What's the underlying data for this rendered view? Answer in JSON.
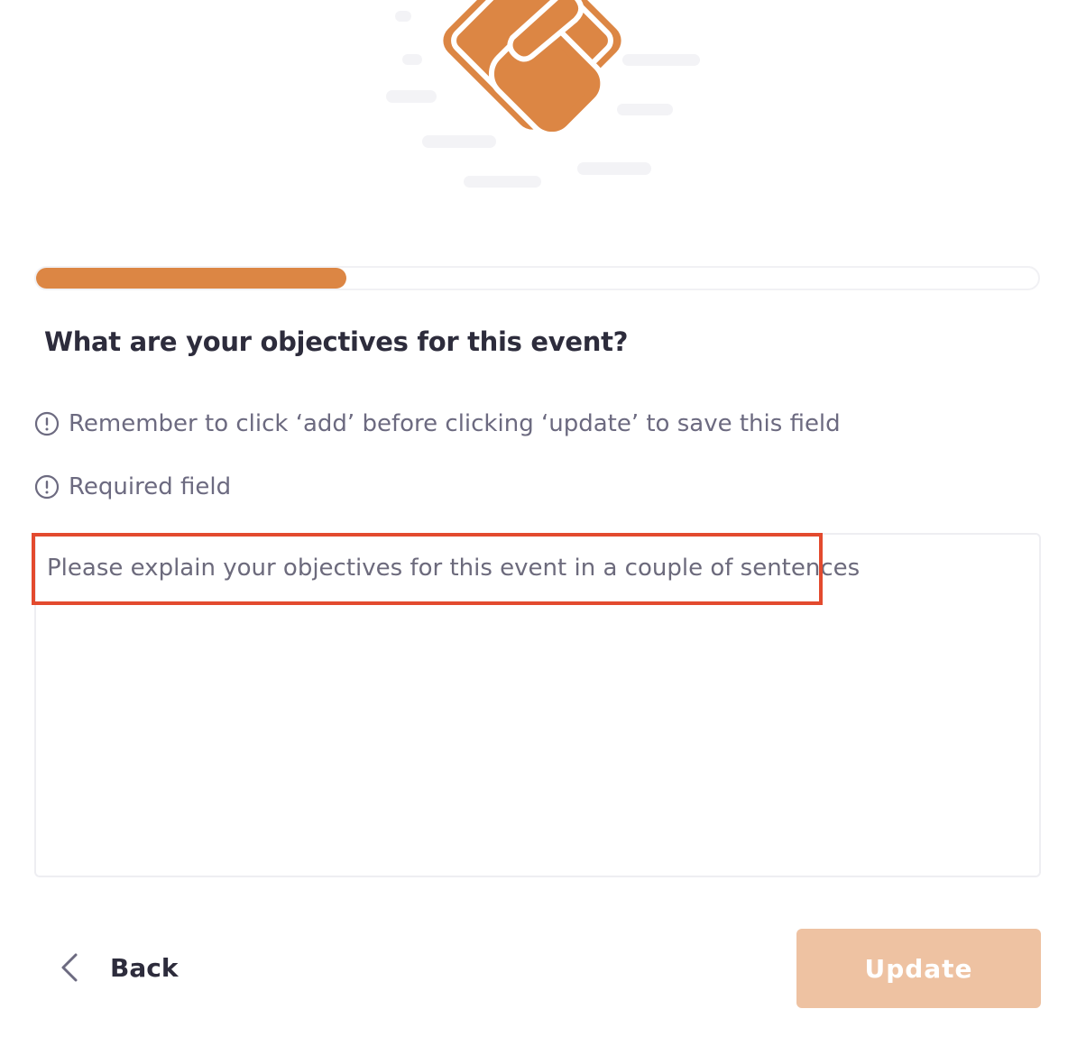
{
  "illustration": {
    "icon": "handshake-icon",
    "accent_color": "#dc8644"
  },
  "progress": {
    "fraction": 0.31,
    "fill_color": "#dc8644"
  },
  "question": {
    "title": "What are your objectives for this event?"
  },
  "notes": [
    {
      "icon": "info-circle-icon",
      "text": "Remember to click ‘add’ before clicking ‘update’ to save this field"
    },
    {
      "icon": "info-circle-icon",
      "text": "Required field"
    }
  ],
  "objectives_field": {
    "value": "",
    "placeholder": "Please explain your objectives for this event in a couple of sentences"
  },
  "footer": {
    "back_label": "Back",
    "update_label": "Update"
  },
  "colors": {
    "accent": "#dc8644",
    "button_disabled": "#eec2a2",
    "highlight": "#e34a2e"
  }
}
